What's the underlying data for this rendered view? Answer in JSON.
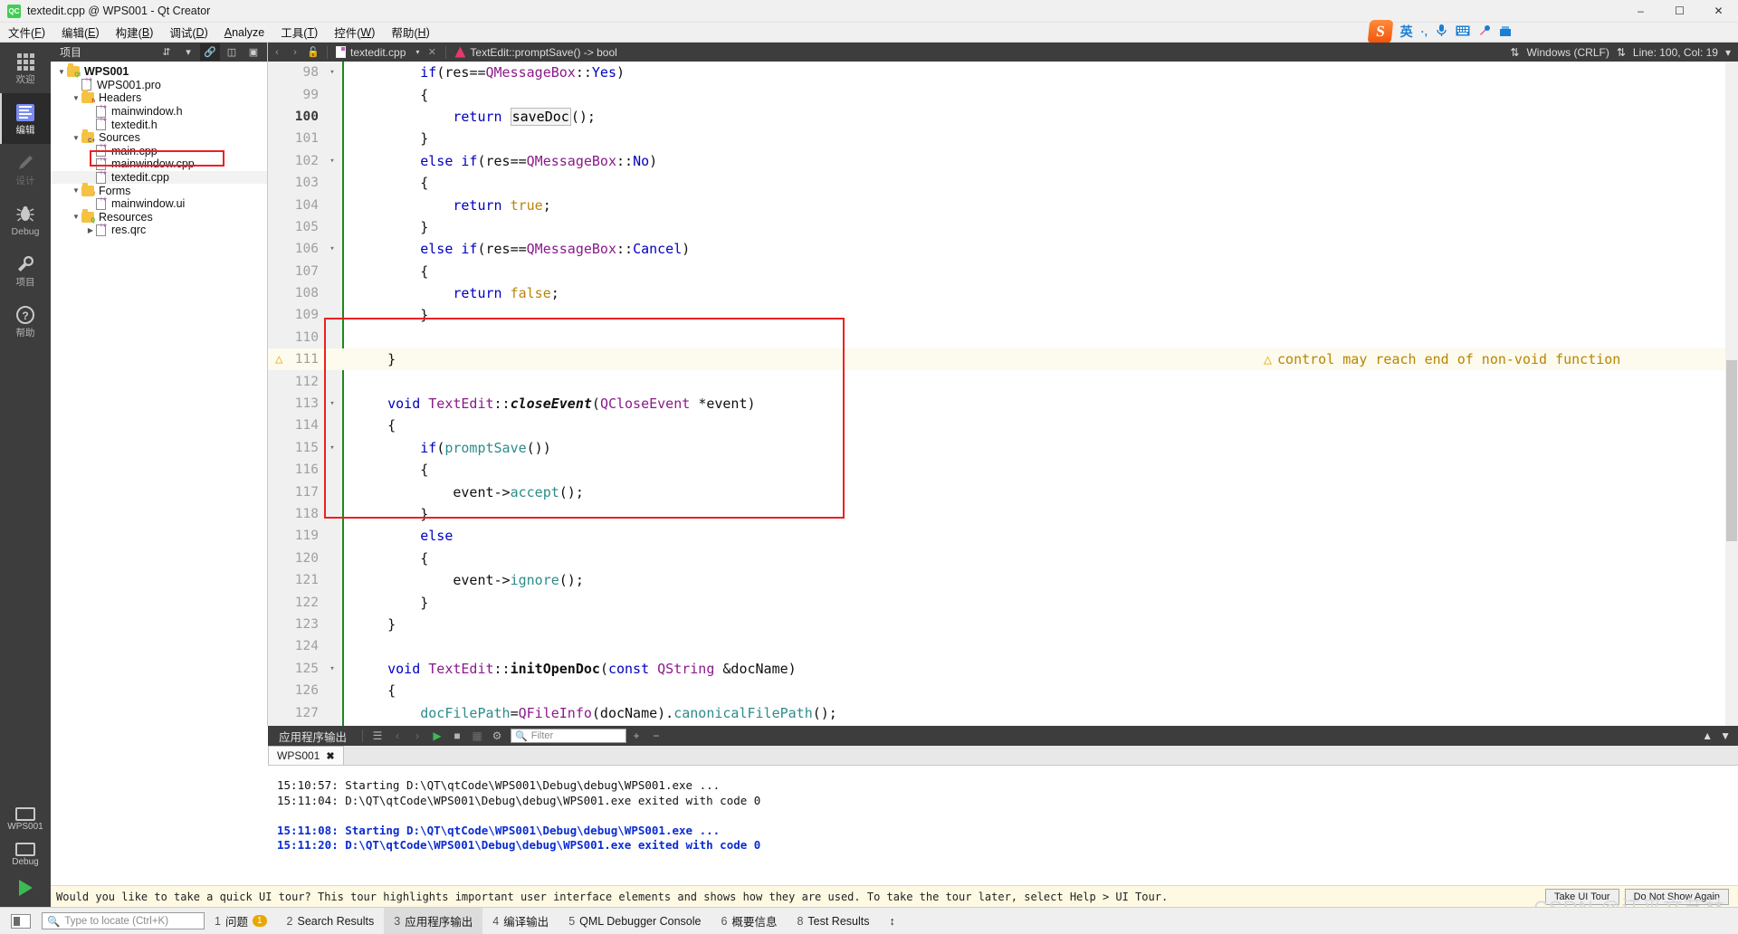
{
  "window": {
    "title": "textedit.cpp @ WPS001 - Qt Creator",
    "app_icon": "qt-creator-icon",
    "minimize": "–",
    "maximize": "☐",
    "close": "✕"
  },
  "menubar": [
    {
      "label": "文件(F)",
      "name": "menu-file"
    },
    {
      "label": "编辑(E)",
      "name": "menu-edit"
    },
    {
      "label": "构建(B)",
      "name": "menu-build"
    },
    {
      "label": "调试(D)",
      "name": "menu-debug"
    },
    {
      "label": "Analyze",
      "name": "menu-analyze"
    },
    {
      "label": "工具(T)",
      "name": "menu-tools"
    },
    {
      "label": "控件(W)",
      "name": "menu-window"
    },
    {
      "label": "帮助(H)",
      "name": "menu-help"
    }
  ],
  "ime": {
    "logo": "S",
    "mode": "英",
    "punct": "·,",
    "mic": "🎤",
    "keyboard": "⌨",
    "tools": "⚒"
  },
  "modebar": {
    "items": [
      {
        "label": "欢迎",
        "icon": "grid-icon",
        "name": "mode-welcome",
        "state": "normal"
      },
      {
        "label": "编辑",
        "icon": "edit-icon",
        "name": "mode-edit",
        "state": "active"
      },
      {
        "label": "设计",
        "icon": "pencil-icon",
        "name": "mode-design",
        "state": "disabled"
      },
      {
        "label": "Debug",
        "icon": "bug-icon",
        "name": "mode-debug",
        "state": "normal"
      },
      {
        "label": "项目",
        "icon": "wrench-icon",
        "name": "mode-projects",
        "state": "normal"
      },
      {
        "label": "帮助",
        "icon": "help-icon",
        "name": "mode-help",
        "state": "normal"
      }
    ],
    "kit": {
      "project": "WPS001",
      "build_config": "Debug"
    },
    "run": "run-button",
    "debug_run": "debug-run-button"
  },
  "project_panel": {
    "header_title": "项目",
    "header_icons": [
      "sort-icon",
      "filter-icon",
      "link-icon",
      "split-icon",
      "close-icon"
    ],
    "tree": [
      {
        "label": "WPS001",
        "indent": 0,
        "type": "project",
        "expand": "▼",
        "bold": true,
        "icon": "folder-qt-icon"
      },
      {
        "label": "WPS001.pro",
        "indent": 1,
        "type": "file",
        "expand": "",
        "bold": false,
        "icon": "file-pro-icon"
      },
      {
        "label": "Headers",
        "indent": 1,
        "type": "folder",
        "expand": "▼",
        "bold": false,
        "icon": "folder-h-icon"
      },
      {
        "label": "mainwindow.h",
        "indent": 2,
        "type": "file",
        "expand": "",
        "bold": false,
        "icon": "file-h-icon"
      },
      {
        "label": "textedit.h",
        "indent": 2,
        "type": "file",
        "expand": "",
        "bold": false,
        "icon": "file-h-icon"
      },
      {
        "label": "Sources",
        "indent": 1,
        "type": "folder",
        "expand": "▼",
        "bold": false,
        "icon": "folder-cpp-icon"
      },
      {
        "label": "main.cpp",
        "indent": 2,
        "type": "file",
        "expand": "",
        "bold": false,
        "icon": "file-cpp-icon"
      },
      {
        "label": "mainwindow.cpp",
        "indent": 2,
        "type": "file",
        "expand": "",
        "bold": false,
        "icon": "file-cpp-icon"
      },
      {
        "label": "textedit.cpp",
        "indent": 2,
        "type": "file",
        "expand": "",
        "bold": false,
        "icon": "file-cpp-icon",
        "highlight": true
      },
      {
        "label": "Forms",
        "indent": 1,
        "type": "folder",
        "expand": "▼",
        "bold": false,
        "icon": "folder-ui-icon"
      },
      {
        "label": "mainwindow.ui",
        "indent": 2,
        "type": "file",
        "expand": "",
        "bold": false,
        "icon": "file-ui-icon"
      },
      {
        "label": "Resources",
        "indent": 1,
        "type": "folder",
        "expand": "▼",
        "bold": false,
        "icon": "folder-qrc-icon"
      },
      {
        "label": "res.qrc",
        "indent": 2,
        "type": "file",
        "expand": "▶",
        "bold": false,
        "icon": "file-qrc-icon"
      }
    ]
  },
  "editor_toolbar": {
    "back": "‹",
    "forward": "›",
    "file_combo": "textedit.cpp",
    "file_caret": "▾",
    "file_close": "✕",
    "symbol_combo": "TextEdit::promptSave() -> bool",
    "symbol_caret": "▾",
    "split_icon": "split-icon",
    "line_ending": "Windows (CRLF)",
    "cursor_position": "Line: 100, Col: 19"
  },
  "editor": {
    "lines": [
      {
        "num": "98",
        "fold": "▾",
        "indent": 8,
        "tokens": [
          {
            "t": "if",
            "c": "kw"
          },
          {
            "t": "(",
            "c": "op"
          },
          {
            "t": "res",
            "c": "id"
          },
          {
            "t": "==",
            "c": "op"
          },
          {
            "t": "QMessageBox",
            "c": "cls"
          },
          {
            "t": "::",
            "c": "op"
          },
          {
            "t": "Yes",
            "c": "kw"
          },
          {
            "t": ")",
            "c": "op"
          }
        ]
      },
      {
        "num": "99",
        "fold": "",
        "indent": 8,
        "tokens": [
          {
            "t": "{",
            "c": "op"
          }
        ]
      },
      {
        "num": "100",
        "fold": "",
        "indent": 12,
        "current": true,
        "tokens": [
          {
            "t": "return ",
            "c": "kw"
          },
          {
            "t": "saveDoc",
            "c": "hl"
          },
          {
            "t": "();",
            "c": "op"
          }
        ]
      },
      {
        "num": "101",
        "fold": "",
        "indent": 8,
        "tokens": [
          {
            "t": "}",
            "c": "op"
          }
        ]
      },
      {
        "num": "102",
        "fold": "▾",
        "indent": 8,
        "tokens": [
          {
            "t": "else ",
            "c": "kw"
          },
          {
            "t": "if",
            "c": "kw"
          },
          {
            "t": "(",
            "c": "op"
          },
          {
            "t": "res",
            "c": "id"
          },
          {
            "t": "==",
            "c": "op"
          },
          {
            "t": "QMessageBox",
            "c": "cls"
          },
          {
            "t": "::",
            "c": "op"
          },
          {
            "t": "No",
            "c": "kw"
          },
          {
            "t": ")",
            "c": "op"
          }
        ]
      },
      {
        "num": "103",
        "fold": "",
        "indent": 8,
        "tokens": [
          {
            "t": "{",
            "c": "op"
          }
        ]
      },
      {
        "num": "104",
        "fold": "",
        "indent": 12,
        "tokens": [
          {
            "t": "return ",
            "c": "kw"
          },
          {
            "t": "true",
            "c": "num"
          },
          {
            "t": ";",
            "c": "op"
          }
        ]
      },
      {
        "num": "105",
        "fold": "",
        "indent": 8,
        "tokens": [
          {
            "t": "}",
            "c": "op"
          }
        ]
      },
      {
        "num": "106",
        "fold": "▾",
        "indent": 8,
        "tokens": [
          {
            "t": "else ",
            "c": "kw"
          },
          {
            "t": "if",
            "c": "kw"
          },
          {
            "t": "(",
            "c": "op"
          },
          {
            "t": "res",
            "c": "id"
          },
          {
            "t": "==",
            "c": "op"
          },
          {
            "t": "QMessageBox",
            "c": "cls"
          },
          {
            "t": "::",
            "c": "op"
          },
          {
            "t": "Cancel",
            "c": "kw"
          },
          {
            "t": ")",
            "c": "op"
          }
        ]
      },
      {
        "num": "107",
        "fold": "",
        "indent": 8,
        "tokens": [
          {
            "t": "{",
            "c": "op"
          }
        ]
      },
      {
        "num": "108",
        "fold": "",
        "indent": 12,
        "tokens": [
          {
            "t": "return ",
            "c": "kw"
          },
          {
            "t": "false",
            "c": "num"
          },
          {
            "t": ";",
            "c": "op"
          }
        ]
      },
      {
        "num": "109",
        "fold": "",
        "indent": 8,
        "tokens": [
          {
            "t": "}",
            "c": "op"
          }
        ]
      },
      {
        "num": "110",
        "fold": "",
        "indent": 0,
        "tokens": []
      },
      {
        "num": "111",
        "fold": "",
        "indent": 4,
        "warning": true,
        "tokens": [
          {
            "t": "}",
            "c": "op"
          }
        ]
      },
      {
        "num": "112",
        "fold": "",
        "indent": 0,
        "tokens": []
      },
      {
        "num": "113",
        "fold": "▾",
        "indent": 4,
        "tokens": [
          {
            "t": "void ",
            "c": "kw"
          },
          {
            "t": "TextEdit",
            "c": "cls"
          },
          {
            "t": "::",
            "c": "op"
          },
          {
            "t": "closeEvent",
            "c": "fn"
          },
          {
            "t": "(",
            "c": "op"
          },
          {
            "t": "QCloseEvent ",
            "c": "cls"
          },
          {
            "t": "*event",
            "c": "op"
          },
          {
            "t": ")",
            "c": "op"
          }
        ]
      },
      {
        "num": "114",
        "fold": "",
        "indent": 4,
        "tokens": [
          {
            "t": "{",
            "c": "op"
          }
        ]
      },
      {
        "num": "115",
        "fold": "▾",
        "indent": 8,
        "tokens": [
          {
            "t": "if",
            "c": "kw"
          },
          {
            "t": "(",
            "c": "op"
          },
          {
            "t": "promptSave",
            "c": "mem"
          },
          {
            "t": "())",
            "c": "op"
          }
        ]
      },
      {
        "num": "116",
        "fold": "",
        "indent": 8,
        "tokens": [
          {
            "t": "{",
            "c": "op"
          }
        ]
      },
      {
        "num": "117",
        "fold": "",
        "indent": 12,
        "tokens": [
          {
            "t": "event->",
            "c": "op"
          },
          {
            "t": "accept",
            "c": "mem"
          },
          {
            "t": "();",
            "c": "op"
          }
        ]
      },
      {
        "num": "118",
        "fold": "",
        "indent": 8,
        "tokens": [
          {
            "t": "}",
            "c": "op"
          }
        ]
      },
      {
        "num": "119",
        "fold": "",
        "indent": 8,
        "tokens": [
          {
            "t": "else",
            "c": "kw"
          }
        ]
      },
      {
        "num": "120",
        "fold": "",
        "indent": 8,
        "tokens": [
          {
            "t": "{",
            "c": "op"
          }
        ]
      },
      {
        "num": "121",
        "fold": "",
        "indent": 12,
        "tokens": [
          {
            "t": "event->",
            "c": "op"
          },
          {
            "t": "ignore",
            "c": "mem"
          },
          {
            "t": "();",
            "c": "op"
          }
        ]
      },
      {
        "num": "122",
        "fold": "",
        "indent": 8,
        "tokens": [
          {
            "t": "}",
            "c": "op"
          }
        ]
      },
      {
        "num": "123",
        "fold": "",
        "indent": 4,
        "tokens": [
          {
            "t": "}",
            "c": "op"
          }
        ]
      },
      {
        "num": "124",
        "fold": "",
        "indent": 0,
        "tokens": []
      },
      {
        "num": "125",
        "fold": "▾",
        "indent": 4,
        "tokens": [
          {
            "t": "void ",
            "c": "kw"
          },
          {
            "t": "TextEdit",
            "c": "cls"
          },
          {
            "t": "::",
            "c": "op"
          },
          {
            "t": "initOpenDoc",
            "c": "fn2"
          },
          {
            "t": "(",
            "c": "op"
          },
          {
            "t": "const ",
            "c": "kw"
          },
          {
            "t": "QString ",
            "c": "cls"
          },
          {
            "t": "&docName",
            "c": "op"
          },
          {
            "t": ")",
            "c": "op"
          }
        ]
      },
      {
        "num": "126",
        "fold": "",
        "indent": 4,
        "tokens": [
          {
            "t": "{",
            "c": "op"
          }
        ]
      },
      {
        "num": "127",
        "fold": "",
        "indent": 8,
        "tokens": [
          {
            "t": "docFilePath",
            "c": "mem"
          },
          {
            "t": "=",
            "c": "op"
          },
          {
            "t": "QFileInfo",
            "c": "cls"
          },
          {
            "t": "(docName).",
            "c": "op"
          },
          {
            "t": "canonicalFilePath",
            "c": "mem"
          },
          {
            "t": "();",
            "c": "op"
          }
        ]
      }
    ],
    "warning_text": "control may reach end of non-void function",
    "warning_icon": "⚠",
    "highlight_box_label": "closeEvent-code-block"
  },
  "output_pane": {
    "title": "应用程序输出",
    "toolbar_icons": [
      "clear-icon",
      "prev-icon",
      "next-icon",
      "run-icon",
      "stop-icon",
      "attach-icon",
      "settings-icon"
    ],
    "filter_placeholder": "Filter",
    "add": "+",
    "remove": "−",
    "tab": {
      "label": "WPS001",
      "close": "✖"
    },
    "lines": [
      {
        "text": "15:10:57: Starting D:\\QT\\qtCode\\WPS001\\Debug\\debug\\WPS001.exe ...",
        "style": "black"
      },
      {
        "text": "15:11:04: D:\\QT\\qtCode\\WPS001\\Debug\\debug\\WPS001.exe exited with code 0",
        "style": "black"
      },
      {
        "text": "",
        "style": "black"
      },
      {
        "text": "15:11:08: Starting D:\\QT\\qtCode\\WPS001\\Debug\\debug\\WPS001.exe ...",
        "style": "blue"
      },
      {
        "text": "15:11:20: D:\\QT\\qtCode\\WPS001\\Debug\\debug\\WPS001.exe exited with code 0",
        "style": "blue"
      }
    ]
  },
  "tour_bar": {
    "message": "Would you like to take a quick UI tour? This tour highlights important user interface elements and shows how they are used. To take the tour later, select Help > UI Tour.",
    "buttons": [
      "Take UI Tour",
      "Do Not Show Again"
    ]
  },
  "statusbar": {
    "toggle_icon": "sidebar-toggle-icon",
    "locate_placeholder": "Type to locate (Ctrl+K)",
    "items": [
      {
        "num": "1",
        "label": "问题",
        "badge": "1",
        "active": false
      },
      {
        "num": "2",
        "label": "Search Results",
        "badge": "",
        "active": false
      },
      {
        "num": "3",
        "label": "应用程序输出",
        "badge": "",
        "active": true
      },
      {
        "num": "4",
        "label": "编译输出",
        "badge": "",
        "active": false
      },
      {
        "num": "5",
        "label": "QML Debugger Console",
        "badge": "",
        "active": false
      },
      {
        "num": "6",
        "label": "概要信息",
        "badge": "",
        "active": false
      },
      {
        "num": "8",
        "label": "Test Results",
        "badge": "",
        "active": false
      }
    ],
    "more": "↕"
  },
  "watermark": "CSDN @江平文艺林",
  "colors": {
    "accent_red": "#ec2024",
    "dark_chrome": "#3d3d3d",
    "warning": "#e8a800",
    "run_green": "#3cba54",
    "output_blue": "#0a2bd2"
  }
}
